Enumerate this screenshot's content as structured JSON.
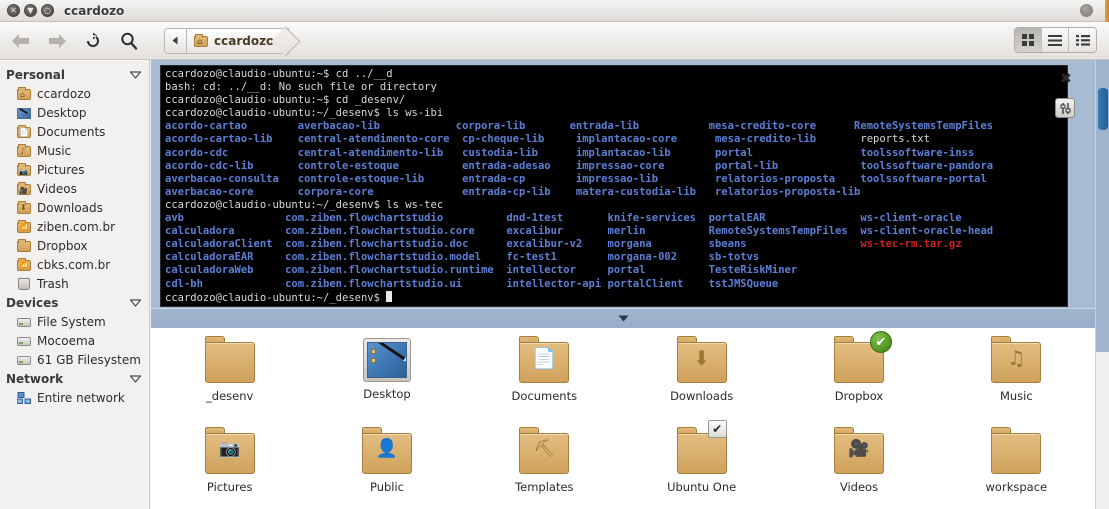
{
  "window": {
    "title": "ccardozo",
    "controls": [
      "close",
      "minimize",
      "maximize"
    ]
  },
  "toolbar": {
    "back_label": "Back",
    "forward_label": "Forward",
    "reload_label": "Reload",
    "search_label": "Search",
    "path_prev_label": "Previous path",
    "breadcrumb": "ccardozo",
    "view_buttons": [
      {
        "name": "icon-view",
        "active": true
      },
      {
        "name": "list-view",
        "active": false
      },
      {
        "name": "compact-view",
        "active": false
      }
    ]
  },
  "sidebar": {
    "groups": [
      {
        "label": "Personal",
        "items": [
          {
            "label": "ccardozo",
            "icon": "home-folder-icon"
          },
          {
            "label": "Desktop",
            "icon": "desktop-folder-icon"
          },
          {
            "label": "Documents",
            "icon": "documents-folder-icon"
          },
          {
            "label": "Music",
            "icon": "music-folder-icon"
          },
          {
            "label": "Pictures",
            "icon": "pictures-folder-icon"
          },
          {
            "label": "Videos",
            "icon": "videos-folder-icon"
          },
          {
            "label": "Downloads",
            "icon": "downloads-folder-icon"
          },
          {
            "label": "ziben.com.br",
            "icon": "remote-folder-icon"
          },
          {
            "label": "Dropbox",
            "icon": "folder-icon"
          },
          {
            "label": "cbks.com.br",
            "icon": "remote-folder-icon"
          },
          {
            "label": "Trash",
            "icon": "trash-icon"
          }
        ]
      },
      {
        "label": "Devices",
        "items": [
          {
            "label": "File System",
            "icon": "drive-icon"
          },
          {
            "label": "Mocoema",
            "icon": "drive-icon"
          },
          {
            "label": "61 GB Filesystem",
            "icon": "drive-icon"
          }
        ]
      },
      {
        "label": "Network",
        "items": [
          {
            "label": "Entire network",
            "icon": "network-icon"
          }
        ]
      }
    ]
  },
  "terminal": {
    "close_label": "✖",
    "prefs_label": "sliders-icon",
    "lines": [
      [
        {
          "t": "ccardozo@claudio-ubuntu:~$ cd ../__d",
          "c": "white"
        }
      ],
      [
        {
          "t": "bash: cd: ../__d: No such file or directory",
          "c": "white"
        }
      ],
      [
        {
          "t": "ccardozo@claudio-ubuntu:~$ cd _desenv/",
          "c": "white"
        }
      ],
      [
        {
          "t": "ccardozo@claudio-ubuntu:~/_desenv$ ls ws-ibi",
          "c": "white"
        }
      ],
      [
        {
          "t": "acordo-cartao        averbacao-lib            corpora-lib       entrada-lib           mesa-credito-core      RemoteSystemsTempFiles",
          "c": "blue"
        }
      ],
      [
        {
          "t": "acordo-cartao-lib    central-atendimento-core  cp-cheque-lib     implantacao-core      mesa-credito-lib       ",
          "c": "blue"
        },
        {
          "t": "reports.txt",
          "c": "white"
        }
      ],
      [
        {
          "t": "acordo-cdc           central-atendimento-lib   custodia-lib      implantacao-lib       portal                 toolssoftware-inss",
          "c": "blue"
        }
      ],
      [
        {
          "t": "acordo-cdc-lib       controle-estoque          entrada-adesao    impressao-core        portal-lib             toolssoftware-pandora",
          "c": "blue"
        }
      ],
      [
        {
          "t": "averbacao-consulta   controle-estoque-lib      entrada-cp        impressao-lib         relatorios-proposta    toolssoftware-portal",
          "c": "blue"
        }
      ],
      [
        {
          "t": "averbacao-core       corpora-core              entrada-cp-lib    matera-custodia-lib   relatorios-proposta-lib",
          "c": "blue"
        }
      ],
      [
        {
          "t": "ccardozo@claudio-ubuntu:~/_desenv$ ls ws-tec",
          "c": "white"
        }
      ],
      [
        {
          "t": "avb                com.ziben.flowchartstudio          dnd-1test       knife-services  portalEAR               ws-client-oracle",
          "c": "blue"
        }
      ],
      [
        {
          "t": "calculadora        com.ziben.flowchartstudio.core     excalibur       merlin          RemoteSystemsTempFiles  ws-client-oracle-head",
          "c": "blue"
        }
      ],
      [
        {
          "t": "calculadoraClient  com.ziben.flowchartstudio.doc      excalibur-v2    morgana         sbeans                  ",
          "c": "blue"
        },
        {
          "t": "ws-tec-rm.tar.gz",
          "c": "red"
        }
      ],
      [
        {
          "t": "calculadoraEAR     com.ziben.flowchartstudio.model    fc-test1        morgana-002     sb-totvs",
          "c": "blue"
        }
      ],
      [
        {
          "t": "calculadoraWeb     com.ziben.flowchartstudio.runtime  intellector     portal          TesteRiskMiner",
          "c": "blue"
        }
      ],
      [
        {
          "t": "cdl-bh             com.ziben.flowchartstudio.ui       intellector-api portalClient    tstJMSQueue",
          "c": "blue"
        }
      ],
      [
        {
          "t": "ccardozo@claudio-ubuntu:~/_desenv$ ",
          "c": "white",
          "cursor": true
        }
      ]
    ]
  },
  "splitter": {
    "handle": "collapse-chevron-icon"
  },
  "files": [
    {
      "label": "_desenv",
      "icon": "folder-icon",
      "glyph": "",
      "emblem": null
    },
    {
      "label": "Desktop",
      "icon": "desktop-image-icon",
      "glyph": "",
      "emblem": null
    },
    {
      "label": "Documents",
      "icon": "documents-folder-icon",
      "glyph": "📄",
      "emblem": null
    },
    {
      "label": "Downloads",
      "icon": "downloads-folder-icon",
      "glyph": "⬇",
      "emblem": null
    },
    {
      "label": "Dropbox",
      "icon": "folder-icon",
      "glyph": "",
      "emblem": "synced-check"
    },
    {
      "label": "Music",
      "icon": "music-folder-icon",
      "glyph": "♫",
      "emblem": null
    },
    {
      "label": "Pictures",
      "icon": "pictures-folder-icon",
      "glyph": "📷",
      "emblem": null
    },
    {
      "label": "Public",
      "icon": "public-folder-icon",
      "glyph": "👤",
      "emblem": null
    },
    {
      "label": "Templates",
      "icon": "templates-folder-icon",
      "glyph": "⛏",
      "emblem": null
    },
    {
      "label": "Ubuntu One",
      "icon": "folder-icon",
      "glyph": "",
      "emblem": "selected-check"
    },
    {
      "label": "Videos",
      "icon": "videos-folder-icon",
      "glyph": "🎥",
      "emblem": null
    },
    {
      "label": "workspace",
      "icon": "folder-icon",
      "glyph": "",
      "emblem": null
    }
  ],
  "colors": {
    "terminal_bg": "#000000",
    "terminal_dir": "#5c7fd6",
    "terminal_archive": "#cc2222",
    "terminal_text": "#d8d8d8",
    "panel_blue": "#a7bcd3",
    "folder": "#d9b06a",
    "window_chrome": "#f2f1f0",
    "accent_orange": "#d4881f"
  }
}
